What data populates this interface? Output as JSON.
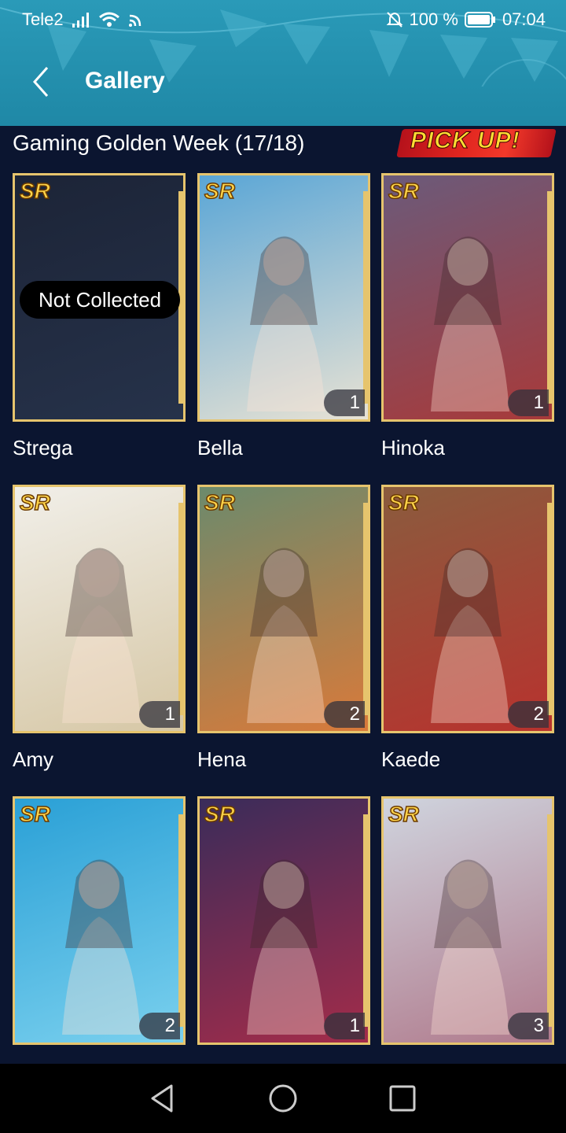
{
  "status_bar": {
    "carrier": "Tele2",
    "battery": "100 %",
    "time": "07:04",
    "icons": [
      "signal-icon",
      "wifi-icon",
      "cast-icon",
      "mute-icon",
      "battery-icon"
    ]
  },
  "header": {
    "title": "Gallery"
  },
  "section": {
    "title": "Gaming Golden Week (17/18)",
    "badge": "PICK UP!"
  },
  "cards": [
    {
      "name": "Strega",
      "rarity": "SR",
      "count": "",
      "collected": false,
      "status": "Not Collected",
      "colors": [
        "#1c2437",
        "#26324a"
      ]
    },
    {
      "name": "Bella",
      "rarity": "SR",
      "count": "1",
      "collected": true,
      "colors": [
        "#5aa6d6",
        "#e8e2d4"
      ]
    },
    {
      "name": "Hinoka",
      "rarity": "SR",
      "count": "1",
      "collected": true,
      "colors": [
        "#6b5a7a",
        "#a83a3a"
      ]
    },
    {
      "name": "Amy",
      "rarity": "SR",
      "count": "1",
      "collected": true,
      "colors": [
        "#f1efe9",
        "#d6c7a5"
      ]
    },
    {
      "name": "Hena",
      "rarity": "SR",
      "count": "2",
      "collected": true,
      "colors": [
        "#6c8a6c",
        "#d97a3a"
      ]
    },
    {
      "name": "Kaede",
      "rarity": "SR",
      "count": "2",
      "collected": true,
      "colors": [
        "#8a5c3e",
        "#b8322e"
      ]
    },
    {
      "name": "",
      "rarity": "SR",
      "count": "2",
      "collected": true,
      "colors": [
        "#2aa0d6",
        "#7ad0ee"
      ]
    },
    {
      "name": "",
      "rarity": "SR",
      "count": "1",
      "collected": true,
      "colors": [
        "#3a2c5a",
        "#a42c4a"
      ]
    },
    {
      "name": "",
      "rarity": "SR",
      "count": "3",
      "collected": true,
      "colors": [
        "#cfd4de",
        "#b07a8c"
      ]
    }
  ],
  "nav_buttons": [
    "back-triangle-icon",
    "home-circle-icon",
    "recents-square-icon"
  ]
}
